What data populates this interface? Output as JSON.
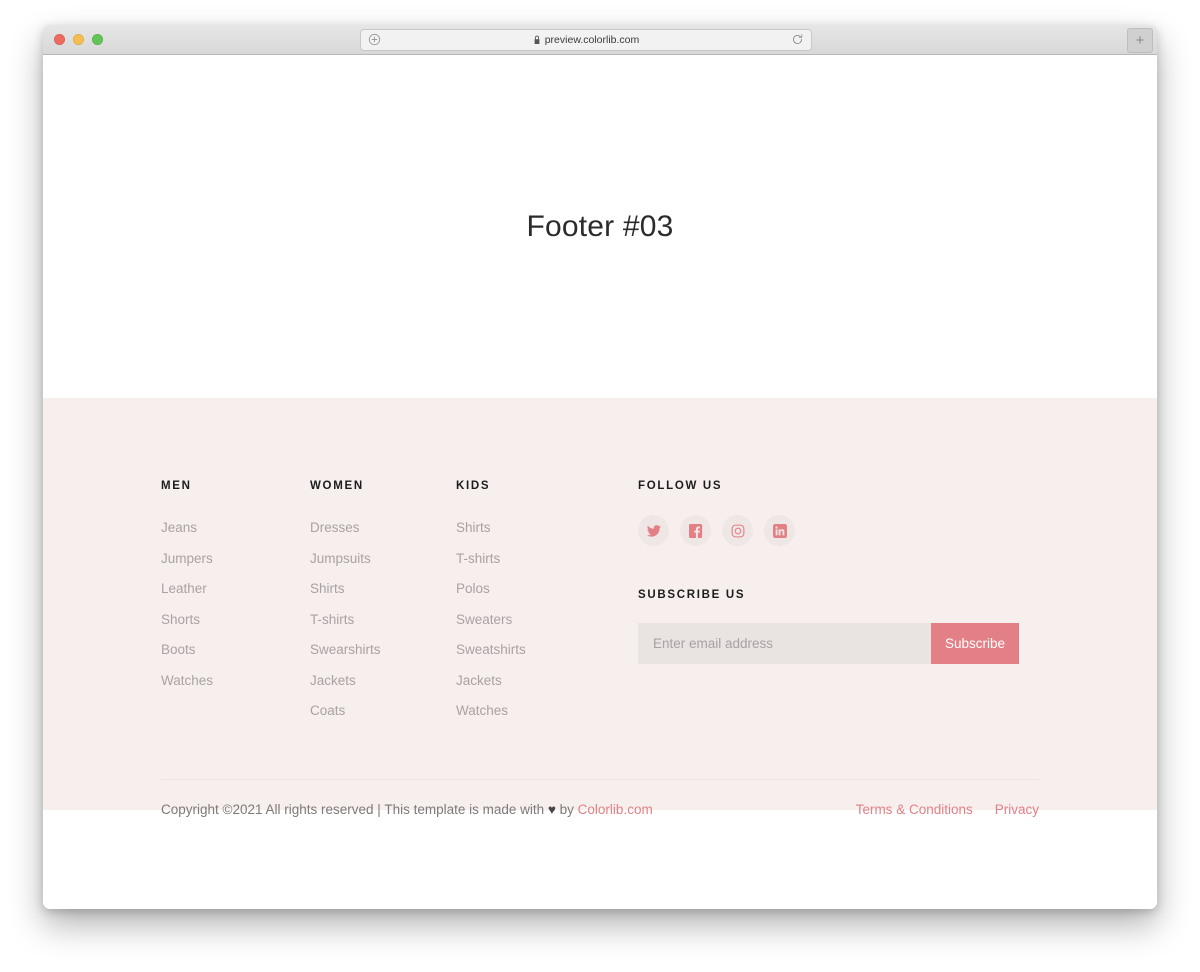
{
  "browser": {
    "url": "preview.colorlib.com",
    "lock_icon": "lock-icon",
    "left_icon": "circle-plus-icon",
    "reload_icon": "reload-icon",
    "newtab_label": "+",
    "traffic_lights": [
      "close-red",
      "minimize-yellow",
      "zoom-green"
    ]
  },
  "hero": {
    "title": "Footer #03"
  },
  "footer": {
    "columns": [
      {
        "title": "MEN",
        "items": [
          "Jeans",
          "Jumpers",
          "Leather",
          "Shorts",
          "Boots",
          "Watches"
        ]
      },
      {
        "title": "WOMEN",
        "items": [
          "Dresses",
          "Jumpsuits",
          "Shirts",
          "T-shirts",
          "Swearshirts",
          "Jackets",
          "Coats"
        ]
      },
      {
        "title": "KIDS",
        "items": [
          "Shirts",
          "T-shirts",
          "Polos",
          "Sweaters",
          "Sweatshirts",
          "Jackets",
          "Watches"
        ]
      }
    ],
    "follow": {
      "title": "FOLLOW US",
      "socials": [
        {
          "name": "twitter-icon",
          "label": "Twitter"
        },
        {
          "name": "facebook-icon",
          "label": "Facebook"
        },
        {
          "name": "instagram-icon",
          "label": "Instagram"
        },
        {
          "name": "linkedin-icon",
          "label": "LinkedIn"
        }
      ]
    },
    "subscribe": {
      "title": "SUBSCRIBE US",
      "placeholder": "Enter email address",
      "value": "",
      "button_label": "Subscribe"
    },
    "bottom": {
      "copyright_prefix": "Copyright ©2021 All rights reserved | This template is made with ",
      "heart": "♥",
      "copyright_by": " by ",
      "brand": "Colorlib.com",
      "links": [
        "Terms & Conditions",
        "Privacy"
      ]
    }
  },
  "colors": {
    "accent": "#e28085",
    "footer_bg": "#f6efee",
    "muted_text": "#a9a2a2",
    "heading_text": "#1c1c1c",
    "input_bg": "#e9e3e2"
  }
}
